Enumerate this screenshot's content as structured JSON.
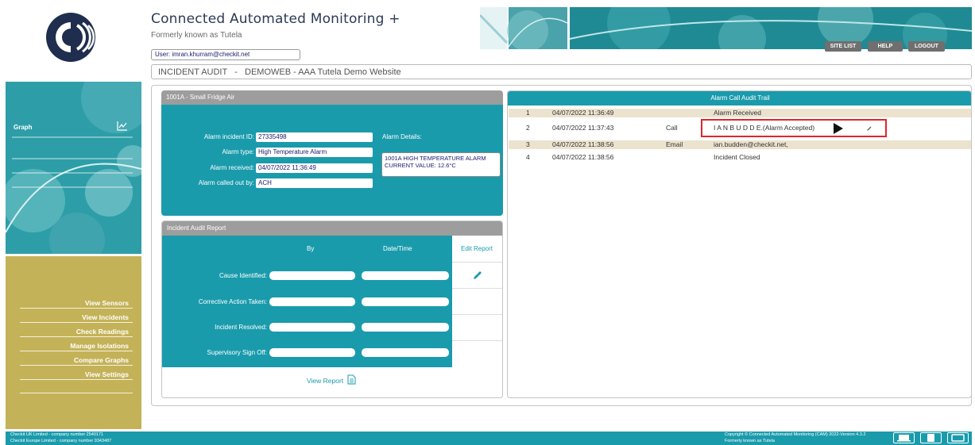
{
  "header": {
    "title": "Connected Automated Monitoring +",
    "subtitle": "Formerly known as Tutela",
    "user_label": "User: imran.khurram@checkit.net",
    "buttons": {
      "site_list": "SITE LIST",
      "help": "HELP",
      "logout": "LOGOUT"
    },
    "breadcrumb": "INCIDENT AUDIT   -   DEMOWEB - AAA Tutela Demo Website"
  },
  "sidebar": {
    "graph_label": "Graph",
    "links": [
      "View Sensors",
      "View Incidents",
      "Check Readings",
      "Manage Isolations",
      "Compare Graphs",
      "View Settings"
    ]
  },
  "alarm": {
    "panel_title": "1001A - Small Fridge Air",
    "labels": {
      "incident_id": "Alarm incident ID:",
      "type": "Alarm type:",
      "received": "Alarm received:",
      "called_out_by": "Alarm called out by:",
      "details": "Alarm Details:"
    },
    "values": {
      "incident_id": "27335498",
      "type": "High Temperature Alarm",
      "received": "04/07/2022 11:36:49",
      "called_out_by": "ACH",
      "details_line1": "1001A HIGH TEMPERATURE ALARM",
      "details_line2": "CURRENT VALUE: 12.6°C"
    }
  },
  "report": {
    "panel_title": "Incident Audit Report",
    "col_by": "By",
    "col_datetime": "Date/Time",
    "edit_label": "Edit Report",
    "rows": [
      "Cause Identified:",
      "Corrective Action Taken:",
      "Incident Resolved:",
      "Supervisory Sign Off:"
    ],
    "view_report": "View Report"
  },
  "trail": {
    "panel_title": "Alarm Call Audit Trail",
    "rows": [
      {
        "num": "1",
        "time": "04/07/2022 11:36:49",
        "type": "",
        "detail": "Alarm Received"
      },
      {
        "num": "2",
        "time": "04/07/2022 11:37:43",
        "type": "Call",
        "detail": "I A N B U D D E.(Alarm Accepted)"
      },
      {
        "num": "3",
        "time": "04/07/2022 11:38:56",
        "type": "Email",
        "detail": "ian.budden@checkit.net,"
      },
      {
        "num": "4",
        "time": "04/07/2022 11:38:56",
        "type": "",
        "detail": "Incident Closed"
      }
    ]
  },
  "footer": {
    "left_line1": "Checkit UK Limited - company number 2540171",
    "left_line2": "Checkit Europe Limited - company number 9343487",
    "right_line1": "Copyright © Connected Automated Monitoring (CAM) 2022-Version 4.3.2",
    "right_line2": "Formerly known as Tutela"
  },
  "colors": {
    "teal": "#1a9bac",
    "gold": "#c4b258",
    "grey_header": "#9d9d9d",
    "highlight": "#e0262b",
    "row_alt": "#ece3cf"
  }
}
